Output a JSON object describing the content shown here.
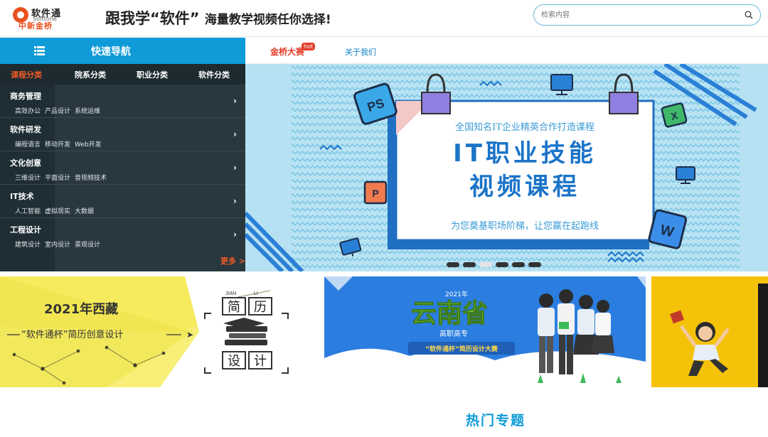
{
  "header": {
    "logo_name": "软件通",
    "logo_en": "Softtone",
    "logo_cn": "中新金桥",
    "slogan_main": "跟我学“软件”",
    "slogan_sub": "海量教学视频任你选择!",
    "search_placeholder": "检索内容"
  },
  "nav": {
    "quick_nav_label": "快速导航",
    "links": [
      {
        "label": "金桥大赛",
        "badge": "hot"
      },
      {
        "label": "关于我们"
      }
    ]
  },
  "categories": {
    "tabs": [
      "课程分类",
      "院系分类",
      "职业分类",
      "软件分类"
    ],
    "active_tab": 0,
    "items": [
      {
        "title": "商务管理",
        "subs": [
          "高效办公",
          "产品设计",
          "系统运维"
        ]
      },
      {
        "title": "软件研发",
        "subs": [
          "编程语言",
          "移动开发",
          "Web开发"
        ]
      },
      {
        "title": "文化创意",
        "subs": [
          "三维设计",
          "平面设计",
          "音视频技术"
        ]
      },
      {
        "title": "IT技术",
        "subs": [
          "人工智能",
          "虚拟现实",
          "大数据"
        ]
      },
      {
        "title": "工程设计",
        "subs": [
          "建筑设计",
          "室内设计",
          "景观设计"
        ]
      }
    ],
    "more": "更多 >"
  },
  "banner": {
    "top_line": "全国知名IT企业精英合作打造课程",
    "title_line1": "IT职业技能",
    "title_line2": "视频课程",
    "bottom_line": "为您奠基职场阶梯，让您赢在起跑线",
    "icon_labels": [
      "PS",
      "X",
      "P",
      "W"
    ],
    "slides": 6,
    "active_slide": 2
  },
  "cards": [
    {
      "title": "2021年西藏",
      "subtitle": "“软件通杯”简历创意设计",
      "tag_en": [
        "JIAN",
        "LI"
      ],
      "tag_cn": [
        "简",
        "历",
        "设",
        "计"
      ]
    },
    {
      "year": "2021年",
      "title": "云南省",
      "sub": "高职高专",
      "ribbon": "“软件通杯”简历设计大赛"
    },
    {}
  ],
  "section": {
    "hot_title": "热门专题"
  },
  "colors": {
    "brand_blue": "#0e9bd8",
    "accent_red": "#e23c2a",
    "panel_dark": "#29383f",
    "banner_blue": "#1f6fc2"
  }
}
